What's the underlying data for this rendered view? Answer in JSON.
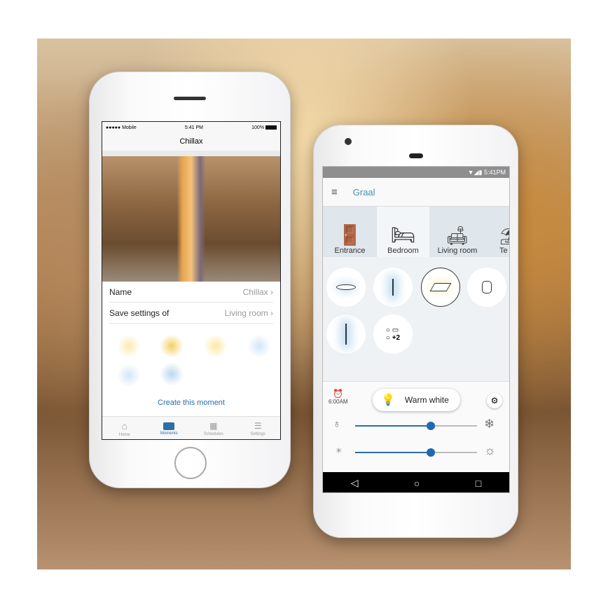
{
  "ios": {
    "status": {
      "carrier": "●●●●● Mobile",
      "time": "5:41 PM",
      "battery": "100%"
    },
    "title": "Chillax",
    "name_label": "Name",
    "name_value": "Chillax",
    "save_label": "Save settings of",
    "save_value": "Living room",
    "create_label": "Create this moment",
    "tabs": [
      {
        "label": "Home",
        "icon": "home-icon"
      },
      {
        "label": "Moments",
        "icon": "moments-icon",
        "active": true
      },
      {
        "label": "Schedules",
        "icon": "schedules-icon"
      },
      {
        "label": "Settings",
        "icon": "settings-icon"
      }
    ],
    "accent": "#2a6fa8"
  },
  "android": {
    "status": {
      "time": "5:41PM"
    },
    "title": "Graal",
    "rooms": [
      {
        "label": "Entrance",
        "icon": "door-icon"
      },
      {
        "label": "Bedroom",
        "icon": "bed-icon",
        "selected": true
      },
      {
        "label": "Living room",
        "icon": "sofa-icon"
      },
      {
        "label": "Te",
        "icon": "terrace-icon"
      }
    ],
    "lights": [
      "ceiling-light-icon",
      "desk-lamp-icon",
      "spotlight-icon",
      "table-lamp-icon",
      "floor-lamp-icon",
      "group-icon"
    ],
    "group_more": "+2",
    "alarm_time": "6:00AM",
    "scene_label": "Warm white",
    "color_temp_percent": 62,
    "brightness_percent": 62,
    "accent": "#4a8fb0"
  }
}
